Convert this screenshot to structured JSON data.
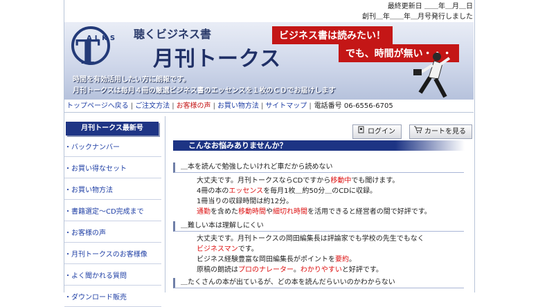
{
  "top_info": {
    "updated": "最終更新日 ＿＿年＿月＿日",
    "founded": "創刊＿年＿＿年＿月号発行しました"
  },
  "banner": {
    "logo_letter": "T",
    "logo_small": "ALKS",
    "subtitle": "聴くビジネス書",
    "title": "月刊トークス",
    "catch1": "ビジネス書は読みたい！",
    "catch2": "でも、時間が無い・・・",
    "desc1": "時間を有効活用したい方に朗報です。",
    "desc2": "月刊トークスは毎月４冊の厳選ビジネス書のエッセンスを１枚のＣＤでお届けします"
  },
  "nav": {
    "items": [
      "トップページへ戻る",
      "ご注文方法",
      "お客様の声",
      "お買い物方法",
      "サイトマップ"
    ],
    "separator": "|",
    "phone": "電話番号 06-6556-6705"
  },
  "sidebar": {
    "header": "月刊トークス最新号",
    "items": [
      "バックナンバー",
      "お買い得なセット",
      "お買い物方法",
      "書籍選定～CD完成まで",
      "お客様の声",
      "月刊トークスのお客様像",
      "よく聞かれる質問",
      "ダウンロード販売"
    ]
  },
  "buttons": {
    "login": "ログイン",
    "cart": "カートを見る"
  },
  "content": {
    "heading": "こんなお悩みありませんか？",
    "q1": "＿本を読んで勉強したいけれど車だから読めない",
    "a1": {
      "l1a": "大丈夫です。月刊トークスならCDですから",
      "l1b": "移動中",
      "l1c": "でも聞けます。",
      "l2a": "4冊の本の",
      "l2b": "エッセンス",
      "l2c": "を毎月1枚＿約50分＿のCDに収録。",
      "l3": "1冊当りの収録時間は約12分。",
      "l4a": "通勤",
      "l4b": "を含めた",
      "l4c": "移動時間",
      "l4d": "や",
      "l4e": "細切れ時間",
      "l4f": "を活用できると経営者の間で好評です。"
    },
    "q2": "＿難しい本は理解しにくい",
    "a2": {
      "l1": "大丈夫です。月刊トークスの岡田編集長は評論家でも学校の先生でもなく",
      "l2": "ビジネスマン",
      "l2b": "です。",
      "l3a": "ビジネス経験豊富な岡田編集長がポイントを",
      "l3b": "要約",
      "l3c": "。",
      "l4a": "原稿の朗読は",
      "l4b": "プロのナレーター",
      "l4c": "。",
      "l4d": "わかりやすい",
      "l4e": "と好評です。"
    },
    "q3": "＿たくさんの本が出ているが、どの本を読んだらいいのかわからない"
  },
  "colors": {
    "navy": "#1d3484",
    "link": "#1f3fa5",
    "accent_red": "#c41616"
  }
}
